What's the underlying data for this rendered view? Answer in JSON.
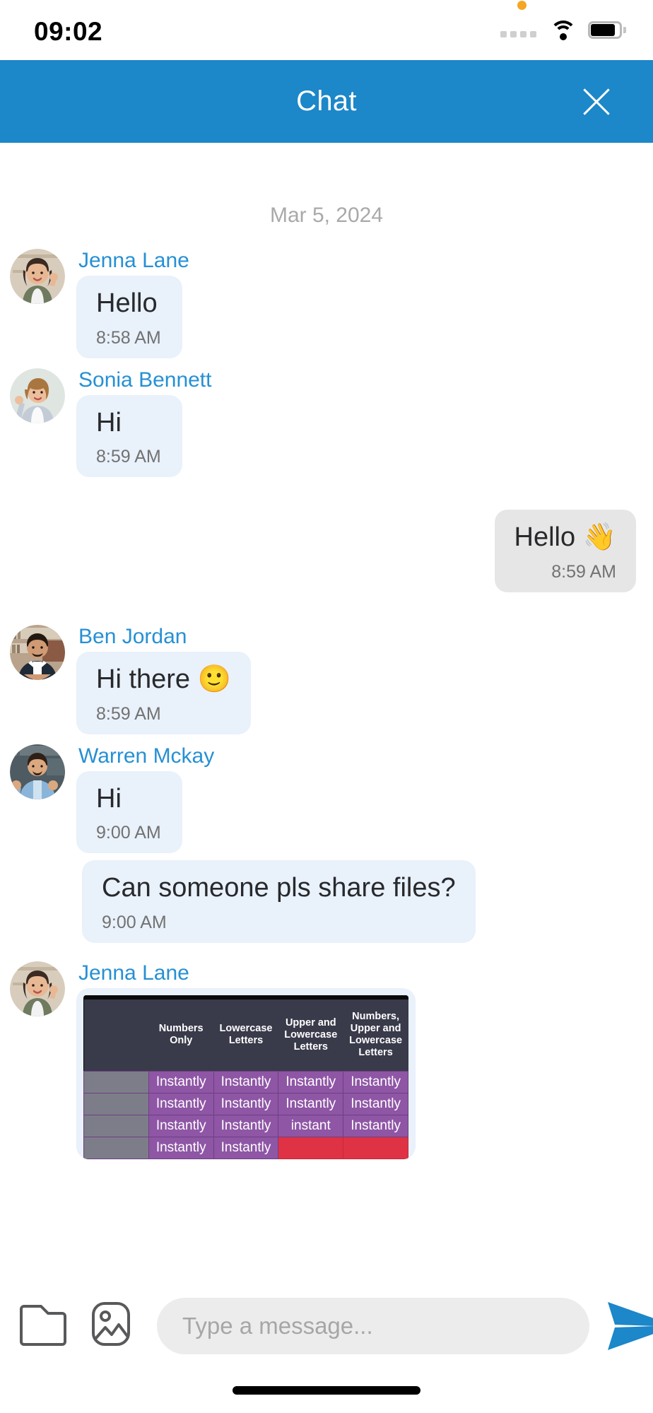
{
  "status_bar": {
    "time": "09:02",
    "icons": [
      "recording-dot",
      "signal-dots",
      "wifi-icon",
      "battery-icon"
    ]
  },
  "header": {
    "title": "Chat",
    "close_label": "×",
    "accent_color": "#1c87c9"
  },
  "chat": {
    "date_separator": "Mar 5, 2024",
    "incoming_bubble_color": "#e9f1fb",
    "outgoing_bubble_color": "#e6e6e6",
    "sender_name_color": "#2690d4",
    "messages": [
      {
        "sender": "Jenna Lane",
        "text": "Hello",
        "time": "8:58 AM",
        "direction": "in",
        "avatar": "woman-waving-green-cardigan"
      },
      {
        "sender": "Sonia Bennett",
        "text": "Hi",
        "time": "8:59 AM",
        "direction": "in",
        "avatar": "woman-smiling-grey-jacket"
      },
      {
        "sender": "",
        "text": "Hello 👋",
        "time": "8:59 AM",
        "direction": "out",
        "avatar": ""
      },
      {
        "sender": "Ben Jordan",
        "text": "Hi there 🙂",
        "time": "8:59 AM",
        "direction": "in",
        "avatar": "man-dark-suit-bookshelf"
      },
      {
        "sender": "Warren Mckay",
        "text": "Hi",
        "time": "9:00 AM",
        "direction": "in",
        "avatar": "man-blue-shirt-hands-up"
      },
      {
        "sender": "",
        "text": "Can someone pls share files?",
        "time": "9:00 AM",
        "direction": "in",
        "avatar": ""
      },
      {
        "sender": "Jenna Lane",
        "text": "",
        "time": "",
        "direction": "in",
        "avatar": "woman-waving-green-cardigan",
        "attachment": "password-strength-table-image"
      }
    ]
  },
  "attachment_table": {
    "headers": [
      "Numbers Only",
      "Lowercase Letters",
      "Upper and Lowercase Letters",
      "Numbers, Upper and Lowercase Letters"
    ],
    "rows": [
      [
        "Instantly",
        "Instantly",
        "Instantly",
        "Instantly"
      ],
      [
        "Instantly",
        "Instantly",
        "Instantly",
        "Instantly"
      ],
      [
        "Instantly",
        "Instantly",
        "instant",
        "Instantly"
      ],
      [
        "Instantly",
        "Instantly",
        "",
        ""
      ]
    ],
    "header_bg": "#393a4a",
    "cell_bg": "#8e56a5",
    "alert_bg": "#e03245"
  },
  "input_bar": {
    "placeholder": "Type a message...",
    "value": "",
    "attach_file_label": "Attach file",
    "attach_image_label": "Attach image",
    "send_label": "Send",
    "send_color": "#1c87c9"
  }
}
